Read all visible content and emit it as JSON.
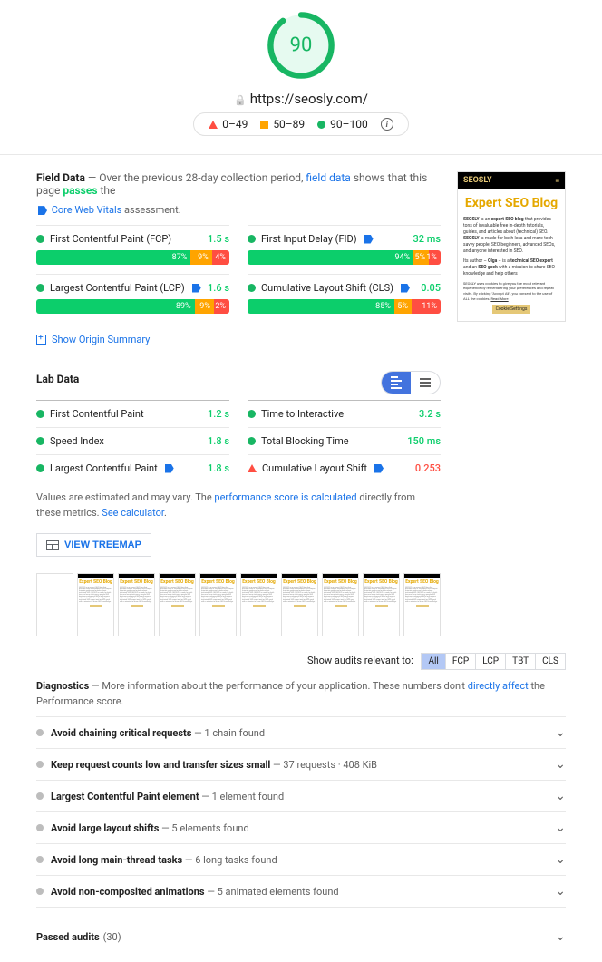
{
  "header": {
    "score": "90",
    "url": "https://seosly.com/",
    "legend": {
      "poor": "0–49",
      "avg": "50–89",
      "good": "90–100"
    }
  },
  "field_data": {
    "title": "Field Data",
    "intro_before": "— Over the previous 28-day collection period, ",
    "intro_link": "field data",
    "intro_after": " shows that this page ",
    "passes": "passes",
    "intro_end": " the ",
    "cwv": "Core Web Vitals",
    "assessment": " assessment.",
    "metrics": [
      {
        "name": "First Contentful Paint (FCP)",
        "tag": false,
        "value": "1.5 s",
        "status": "green",
        "dist": [
          {
            "p": "87%",
            "c": "g"
          },
          {
            "p": "9%",
            "c": "o"
          },
          {
            "p": "4%",
            "c": "r"
          }
        ],
        "widths": [
          80,
          11,
          9
        ]
      },
      {
        "name": "First Input Delay (FID)",
        "tag": true,
        "value": "32 ms",
        "status": "green",
        "dist": [
          {
            "p": "94%",
            "c": "g"
          },
          {
            "p": "5%",
            "c": "o"
          },
          {
            "p": "1%",
            "c": "r"
          }
        ],
        "widths": [
          86,
          8,
          6
        ]
      },
      {
        "name": "Largest Contentful Paint (LCP)",
        "tag": true,
        "value": "1.6 s",
        "status": "green",
        "dist": [
          {
            "p": "89%",
            "c": "g"
          },
          {
            "p": "9%",
            "c": "o"
          },
          {
            "p": "2%",
            "c": "r"
          }
        ],
        "widths": [
          82,
          10,
          8
        ]
      },
      {
        "name": "Cumulative Layout Shift (CLS)",
        "tag": true,
        "value": "0.05",
        "status": "green",
        "dist": [
          {
            "p": "85%",
            "c": "g"
          },
          {
            "p": "5%",
            "c": "o"
          },
          {
            "p": "11%",
            "c": "r"
          }
        ],
        "widths": [
          76,
          9,
          15
        ]
      }
    ],
    "origin_link": "Show Origin Summary"
  },
  "lab_data": {
    "title": "Lab Data",
    "metrics": [
      {
        "name": "First Contentful Paint",
        "tag": false,
        "value": "1.2 s",
        "status": "green",
        "shape": "circle"
      },
      {
        "name": "Time to Interactive",
        "tag": false,
        "value": "3.2 s",
        "status": "green",
        "shape": "circle"
      },
      {
        "name": "Speed Index",
        "tag": false,
        "value": "1.8 s",
        "status": "green",
        "shape": "circle"
      },
      {
        "name": "Total Blocking Time",
        "tag": false,
        "value": "150 ms",
        "status": "green",
        "shape": "circle"
      },
      {
        "name": "Largest Contentful Paint",
        "tag": true,
        "value": "1.8 s",
        "status": "green",
        "shape": "circle"
      },
      {
        "name": "Cumulative Layout Shift",
        "tag": true,
        "value": "0.253",
        "status": "red",
        "shape": "triangle"
      }
    ],
    "note_before": "Values are estimated and may vary. The ",
    "note_link": "performance score is calculated",
    "note_after": " directly from these metrics. ",
    "note_link2": "See calculator",
    "treemap_btn": "VIEW TREEMAP"
  },
  "filter": {
    "label": "Show audits relevant to:",
    "options": [
      "All",
      "FCP",
      "LCP",
      "TBT",
      "CLS"
    ],
    "active": "All"
  },
  "diagnostics": {
    "title": "Diagnostics",
    "sub_before": "— More information about the performance of your application. These numbers don't ",
    "sub_link": "directly affect",
    "sub_after": " the Performance score.",
    "items": [
      {
        "title": "Avoid chaining critical requests",
        "detail": "— 1 chain found"
      },
      {
        "title": "Keep request counts low and transfer sizes small",
        "detail": "— 37 requests · 408 KiB"
      },
      {
        "title": "Largest Contentful Paint element",
        "detail": "— 1 element found"
      },
      {
        "title": "Avoid large layout shifts",
        "detail": "— 5 elements found"
      },
      {
        "title": "Avoid long main-thread tasks",
        "detail": "— 6 long tasks found"
      },
      {
        "title": "Avoid non-composited animations",
        "detail": "— 5 animated elements found"
      }
    ]
  },
  "passed": {
    "title": "Passed audits",
    "count": "(30)"
  },
  "preview": {
    "brand": "SEOSLY",
    "title": "Expert SEO Blog"
  }
}
